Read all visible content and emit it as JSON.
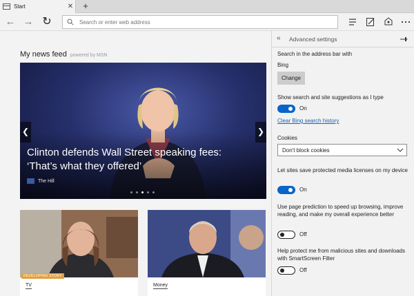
{
  "tab": {
    "title": "Start",
    "close_glyph": "✕"
  },
  "new_tab_glyph": "+",
  "toolbar": {
    "back_glyph": "←",
    "forward_glyph": "→",
    "refresh_glyph": "↻",
    "address_placeholder": "Search or enter web address"
  },
  "icons": [
    "tab-page-icon",
    "search-icon",
    "hub-icon",
    "web-note-icon",
    "share-icon",
    "more-icon",
    "pin-icon",
    "chevron-down-icon"
  ],
  "news": {
    "title": "My news feed",
    "powered_by": "powered by MSN",
    "hero": {
      "headline": "Clinton defends Wall Street speaking fees: ‘That’s what they offered’",
      "source": "The Hill",
      "slide_count": 5,
      "active_slide": 3,
      "prev_glyph": "❮",
      "next_glyph": "❯"
    },
    "cards": [
      {
        "category": "TV",
        "badge": "DEVELOPING STORY"
      },
      {
        "category": "Money"
      }
    ]
  },
  "settings": {
    "title": "Advanced settings",
    "back_glyph": "«",
    "address_bar_search_label": "Search in the address bar with",
    "address_bar_search_value": "Bing",
    "change_button": "Change",
    "suggestions": {
      "label": "Show search and site suggestions as I type",
      "state": "On",
      "on": true
    },
    "clear_history_link": "Clear Bing search history",
    "cookies": {
      "label": "Cookies",
      "value": "Don't block cookies"
    },
    "protected_media": {
      "label": "Let sites save protected media licenses on my device",
      "state": "On",
      "on": true
    },
    "page_prediction": {
      "label": "Use page prediction to speed up browsing, improve reading, and make my overall experience better",
      "state": "Off",
      "on": false
    },
    "smartscreen": {
      "label": "Help protect me from malicious sites and downloads with SmartScreen Filter",
      "state": "Off",
      "on": false
    }
  },
  "colors": {
    "accent": "#0a64c8",
    "link": "#1a5fb4",
    "badge": "#e2a03f",
    "hero_bg": "#26306c"
  }
}
